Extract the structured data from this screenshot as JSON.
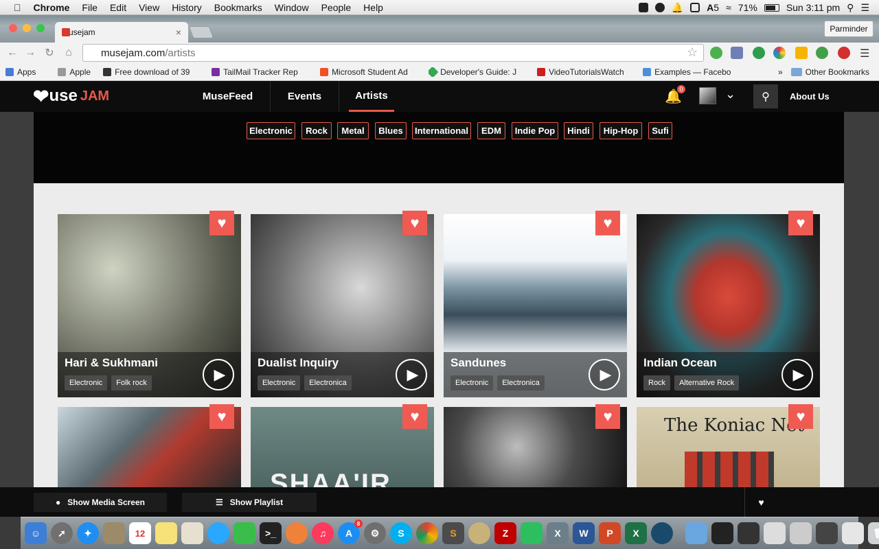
{
  "menubar": {
    "items": [
      "Chrome",
      "File",
      "Edit",
      "View",
      "History",
      "Bookmarks",
      "Window",
      "People",
      "Help"
    ],
    "battery": "71%",
    "clock": "Sun 3:11 pm",
    "adobe_count": "5"
  },
  "browser": {
    "tab_title": "Musejam",
    "profile": "Parminder",
    "url_host": "musejam.com",
    "url_path": "/artists",
    "bookmarks": [
      {
        "label": "Apps",
        "color": "#4a7bd5"
      },
      {
        "label": "Apple",
        "color": "#999999"
      },
      {
        "label": "Free download of 39",
        "color": "#333333"
      },
      {
        "label": "TailMail Tracker Rep",
        "color": "#7b2ea0"
      },
      {
        "label": "Microsoft Student Ad",
        "color": "#f25022"
      },
      {
        "label": "Developer's Guide: J",
        "color": "#34a853"
      },
      {
        "label": "VideoTutorialsWatch",
        "color": "#cc1f1f"
      },
      {
        "label": "Examples — Facebo",
        "color": "#4a90d9"
      }
    ],
    "other_bookmarks": "Other Bookmarks",
    "more": "»"
  },
  "site": {
    "logo_main": "use",
    "logo_accent": "JAM",
    "logo_letter": "M",
    "nav": [
      "MuseFeed",
      "Events",
      "Artists"
    ],
    "active_nav": "Artists",
    "notif_count": "0",
    "about": "About Us",
    "genres": [
      "Electronic",
      "Rock",
      "Metal",
      "Blues",
      "International",
      "EDM",
      "Indie Pop",
      "Hindi",
      "Hip-Hop",
      "Sufi"
    ]
  },
  "artists": [
    {
      "name": "Hari & Sukhmani",
      "tags": [
        "Electronic",
        "Folk rock"
      ]
    },
    {
      "name": "Dualist Inquiry",
      "tags": [
        "Electronic",
        "Electronica"
      ]
    },
    {
      "name": "Sandunes",
      "tags": [
        "Electronic",
        "Electronica"
      ]
    },
    {
      "name": "Indian Ocean",
      "tags": [
        "Rock",
        "Alternative Rock"
      ]
    }
  ],
  "artists_row2": [
    {
      "image_text": ""
    },
    {
      "image_text": "SHAA'IR"
    },
    {
      "image_text": ""
    },
    {
      "image_text": "The Koniac Net"
    }
  ],
  "player": {
    "media_screen": "Show Media Screen",
    "playlist": "Show Playlist"
  },
  "colors": {
    "accent": "#e8594a",
    "heart": "#ef5b52"
  },
  "dock": {
    "calendar_day": "12",
    "appstore_badge": "8"
  }
}
